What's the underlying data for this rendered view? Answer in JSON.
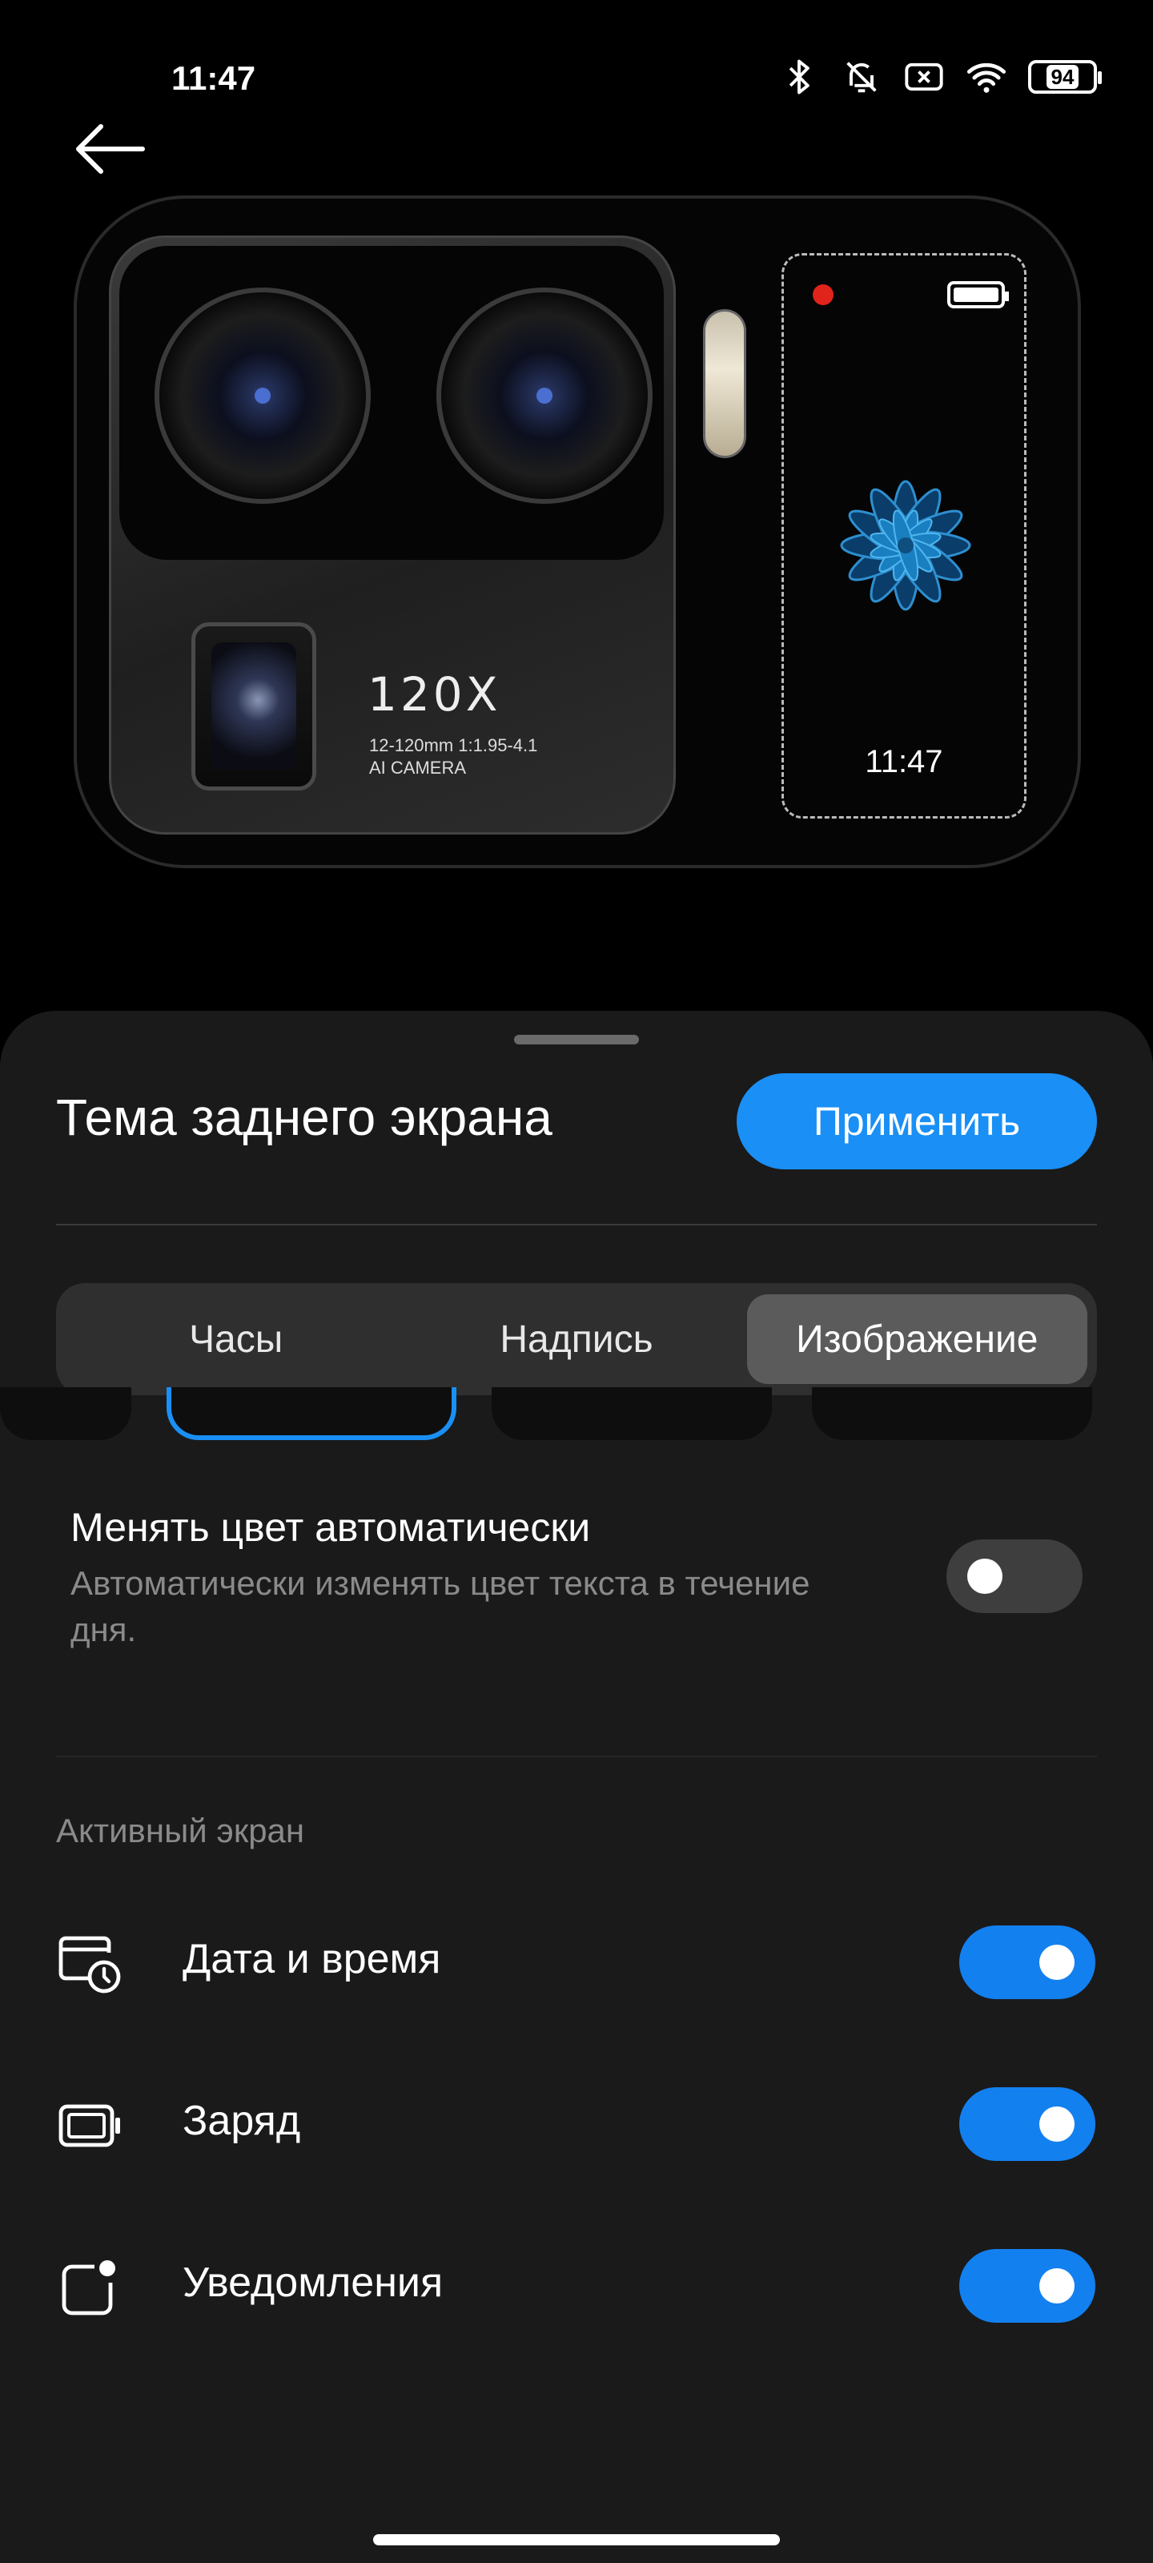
{
  "status_bar": {
    "time": "11:47",
    "battery": "94",
    "icons": [
      "bluetooth-icon",
      "vibrate-off-icon",
      "no-sim-icon",
      "wifi-icon",
      "battery-icon"
    ]
  },
  "preview": {
    "camera_zoom": "120X",
    "camera_specs": "12-120mm 1:1.95-4.1\nAI CAMERA",
    "rear_screen_time": "11:47"
  },
  "sheet": {
    "title": "Тема заднего экрана",
    "apply_label": "Применить",
    "tabs": [
      {
        "label": "Часы",
        "active": false
      },
      {
        "label": "Надпись",
        "active": false
      },
      {
        "label": "Изображение",
        "active": true
      }
    ],
    "auto_color": {
      "title": "Менять цвет автоматически",
      "subtitle": "Автоматически изменять цвет текста в течение дня.",
      "enabled": false
    },
    "active_screen": {
      "label": "Активный экран",
      "items": [
        {
          "label": "Дата и время",
          "icon": "calendar-clock-icon",
          "enabled": true
        },
        {
          "label": "Заряд",
          "icon": "battery-icon",
          "enabled": true
        },
        {
          "label": "Уведомления",
          "icon": "notification-icon",
          "enabled": true
        }
      ]
    }
  },
  "colors": {
    "accent": "#1a8ff5",
    "sheet_bg": "#1a1a1a",
    "toggle_on": "#1380f0",
    "toggle_off": "#3e3e3e"
  }
}
